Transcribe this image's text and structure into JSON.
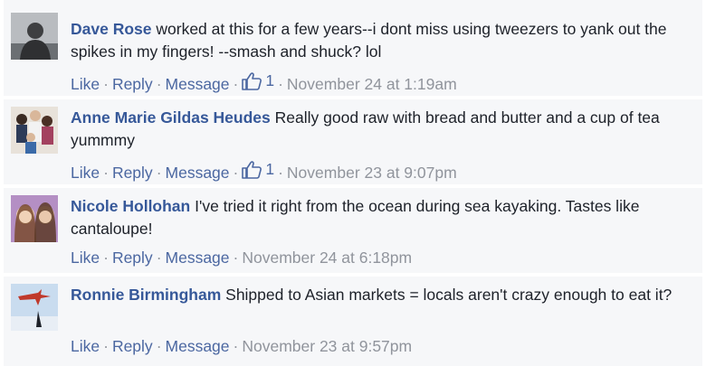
{
  "actions": {
    "like": "Like",
    "reply": "Reply",
    "message": "Message",
    "separator": "·"
  },
  "comments": [
    {
      "author": "Dave Rose",
      "text": "worked at this for a few years--i dont miss using tweezers to yank out the spikes in my fingers! --smash and shuck? lol",
      "likes": "1",
      "timestamp": "November 24 at 1:19am"
    },
    {
      "author": "Anne Marie Gildas Heudes",
      "text": "Really good raw with bread and butter and a cup of tea yummmy",
      "likes": "1",
      "timestamp": "November 23 at 9:07pm"
    },
    {
      "author": "Nicole Hollohan",
      "text": "I've tried it right from the ocean during sea kayaking. Tastes like cantaloupe!",
      "likes": null,
      "timestamp": "November 24 at 6:18pm"
    },
    {
      "author": "Ronnie Birmingham",
      "text": "Shipped to Asian markets = locals aren't crazy enough to eat it?",
      "likes": null,
      "timestamp": "November 23 at 9:57pm"
    }
  ]
}
